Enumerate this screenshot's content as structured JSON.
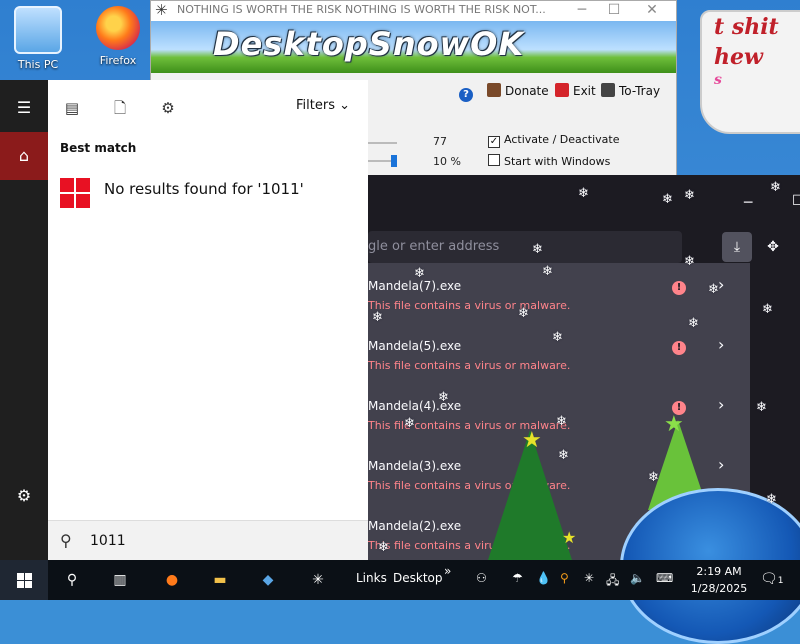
{
  "desktop": {
    "icons": [
      {
        "label": "This PC"
      },
      {
        "label": "Firefox"
      }
    ],
    "sign_lines": [
      "t shit",
      "hew",
      "s"
    ]
  },
  "snow_window": {
    "title": "NOTHING IS WORTH THE RISK NOTHING IS WORTH THE RISK NOT...",
    "brand": "DesktopSnowOK",
    "toolbar": {
      "donate": "Donate",
      "exit": "Exit",
      "to_tray": "To-Tray"
    },
    "settings": {
      "value_1": "77",
      "value_2": "10 %",
      "activate_label": "Activate / Deactivate",
      "activate_checked": true,
      "start_with_windows_label": "Start with Windows",
      "start_with_windows_checked": false
    }
  },
  "browser": {
    "address_placeholder": "gle or enter address",
    "downloads": [
      {
        "name": "Mandela(7).exe",
        "status": "This file contains a virus or malware."
      },
      {
        "name": "Mandela(5).exe",
        "status": "This file contains a virus or malware."
      },
      {
        "name": "Mandela(4).exe",
        "status": "This file contains a virus or malware."
      },
      {
        "name": "Mandela(3).exe",
        "status": "This file contains a virus or malware."
      },
      {
        "name": "Mandela(2).exe",
        "status": "This file contains a virus or malware."
      }
    ]
  },
  "start_menu": {
    "filters_label": "Filters",
    "best_match_label": "Best match",
    "no_results": "No results found for '1011'",
    "search_value": "1011"
  },
  "taskbar": {
    "links_label": "Links",
    "desktop_label": "Desktop",
    "time": "2:19 AM",
    "date": "1/28/2025",
    "notification_count": "1"
  },
  "colors": {
    "start_accent": "#8b1b1b",
    "malware_warning": "#ff848b",
    "dark_panel": "#42414d"
  }
}
